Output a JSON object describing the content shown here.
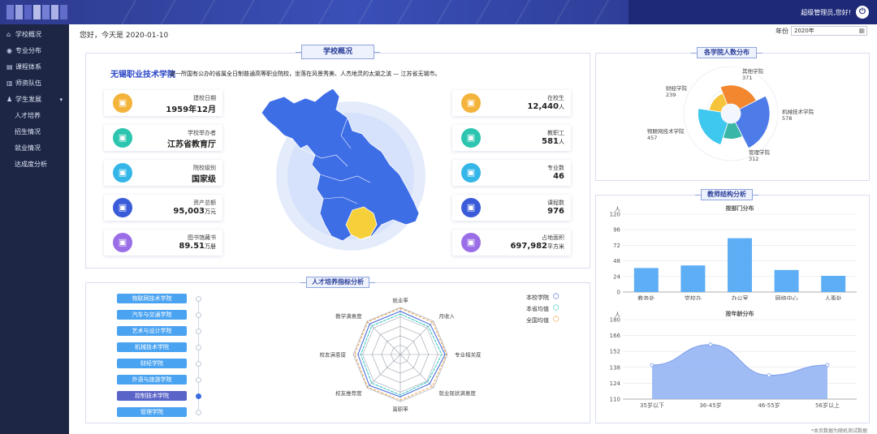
{
  "app": {
    "user": "超级管理员,您好!",
    "logo_colors": [
      "#6f7bd0",
      "#9aa3e0",
      "#5865c4",
      "#b7bde8",
      "#7480d4",
      "#aab1e6",
      "#616dc8"
    ]
  },
  "sidebar": {
    "items": [
      {
        "label": "学校概况",
        "icon": "school-icon"
      },
      {
        "label": "专业分布",
        "icon": "location-pin-icon"
      },
      {
        "label": "课程体系",
        "icon": "book-icon"
      },
      {
        "label": "师资队伍",
        "icon": "teacher-icon"
      },
      {
        "label": "学生发展",
        "icon": "student-icon",
        "expanded": true
      }
    ],
    "subitems": [
      "人才培养",
      "招生情况",
      "就业情况",
      "达成度分析"
    ]
  },
  "header": {
    "greeting": "您好，今天是 2020-01-10",
    "year_label": "年份",
    "year_value": "2020年"
  },
  "overview": {
    "title": "学校概况",
    "school_name": "无锡职业技术学院",
    "description": "是一所国有公办的省属全日制普通高等职业院校，坐落在风景秀美、人杰地灵的太湖之滨 — 江苏省无锡市。",
    "left_cards": [
      {
        "label": "建校日期",
        "value": "1959年12月",
        "unit": "",
        "icon": "calendar-icon",
        "color": "#f4b33a"
      },
      {
        "label": "学校举办者",
        "value": "江苏省教育厅",
        "unit": "",
        "icon": "people-icon",
        "color": "#2cc5b0"
      },
      {
        "label": "院校级别",
        "value": "国家级",
        "unit": "",
        "icon": "building-icon",
        "color": "#35b6e8"
      },
      {
        "label": "资产总额",
        "value": "95,003",
        "unit": "万元",
        "icon": "money-bag-icon",
        "color": "#3a5cd8"
      },
      {
        "label": "图书馆藏书",
        "value": "89.51",
        "unit": "万册",
        "icon": "books-icon",
        "color": "#9a6ee6"
      }
    ],
    "right_cards": [
      {
        "label": "在校生",
        "value": "12,440",
        "unit": "人",
        "icon": "graduate-icon",
        "color": "#f4b33a"
      },
      {
        "label": "教职工",
        "value": "581",
        "unit": "人",
        "icon": "staff-icon",
        "color": "#2cc5b0"
      },
      {
        "label": "专业数",
        "value": "46",
        "unit": "",
        "icon": "open-book-icon",
        "color": "#35b6e8"
      },
      {
        "label": "课程数",
        "value": "976",
        "unit": "",
        "icon": "clipboard-icon",
        "color": "#3a5cd8"
      },
      {
        "label": "占地面积",
        "value": "697,982",
        "unit": "平方米",
        "icon": "campus-icon",
        "color": "#9a6ee6"
      }
    ],
    "map": {
      "region_color": "#3e6ee6",
      "highlight_color": "#f5d03a"
    }
  },
  "talent": {
    "title": "人才培养指标分析",
    "colleges": [
      "物联网技术学院",
      "汽车与交通学院",
      "艺术与设计学院",
      "机械技术学院",
      "财经学院",
      "外语与旅游学院",
      "控制技术学院",
      "管理学院"
    ],
    "selected_index": 6,
    "radar_axes": [
      "就业率",
      "月收入",
      "专业相关度",
      "就业现状满意度",
      "离职率",
      "校友推荐度",
      "校友满意度",
      "教学满意度"
    ],
    "legend": [
      {
        "label": "本校学院",
        "color": "#3b5fd8"
      },
      {
        "label": "本省均值",
        "color": "#2cc5c0"
      },
      {
        "label": "全国均值",
        "color": "#f09a3a"
      }
    ]
  },
  "college_dist": {
    "title": "各学院人数分布",
    "labels": [
      {
        "name": "其他学院",
        "value": "371"
      },
      {
        "name": "机械技术学院",
        "value": "578"
      },
      {
        "name": "管理学院",
        "value": "312"
      },
      {
        "name": "物联网技术学院",
        "value": "457"
      },
      {
        "name": "财经学院",
        "value": "239"
      }
    ]
  },
  "teacher": {
    "title": "教师结构分析",
    "by_dept_title": "按部门分布",
    "by_age_title": "按年龄分布",
    "unit_label": "人"
  },
  "footnote": "*本页数据为随机测试数据",
  "chart_data": [
    {
      "type": "pie",
      "subtype": "rose",
      "title": "各学院人数分布",
      "categories": [
        "其他学院",
        "机械技术学院",
        "管理学院",
        "物联网技术学院",
        "财经学院"
      ],
      "values": [
        371,
        578,
        312,
        457,
        239
      ],
      "colors": [
        "#f2872f",
        "#4d7be8",
        "#39b6a6",
        "#3ec7ef",
        "#f5c43a"
      ]
    },
    {
      "type": "bar",
      "title": "按部门分布",
      "ylabel": "人",
      "categories": [
        "教务处",
        "党校办",
        "办公室",
        "网络中心",
        "人事处"
      ],
      "values": [
        37,
        41,
        83,
        34,
        25
      ],
      "ylim": [
        0,
        120
      ],
      "yticks": [
        0,
        24,
        48,
        72,
        96,
        120
      ],
      "color": "#5eaef5",
      "grid": true
    },
    {
      "type": "area",
      "title": "按年龄分布",
      "ylabel": "人",
      "categories": [
        "35岁以下",
        "36-45岁",
        "46-55岁",
        "56岁以上"
      ],
      "values": [
        140,
        158,
        131,
        140
      ],
      "ylim": [
        110,
        180
      ],
      "yticks": [
        110,
        124,
        138,
        152,
        166,
        180
      ],
      "color": "#8fb0f3",
      "grid": true
    },
    {
      "type": "radar",
      "title": "人才培养指标分析",
      "axes": [
        "就业率",
        "月收入",
        "专业相关度",
        "就业现状满意度",
        "离职率",
        "校友推荐度",
        "校友满意度",
        "教学满意度"
      ],
      "series": [
        {
          "name": "本校学院",
          "values": [
            0.92,
            0.9,
            0.95,
            0.88,
            0.9,
            0.93,
            0.9,
            0.92
          ],
          "color": "#3b5fd8"
        },
        {
          "name": "本省均值",
          "values": [
            0.86,
            0.84,
            0.88,
            0.82,
            0.86,
            0.86,
            0.84,
            0.86
          ],
          "color": "#2cc5c0"
        },
        {
          "name": "全国均值",
          "values": [
            0.98,
            0.97,
            0.98,
            0.96,
            0.97,
            0.98,
            0.97,
            0.98
          ],
          "color": "#f09a3a"
        }
      ],
      "max": 1
    }
  ]
}
